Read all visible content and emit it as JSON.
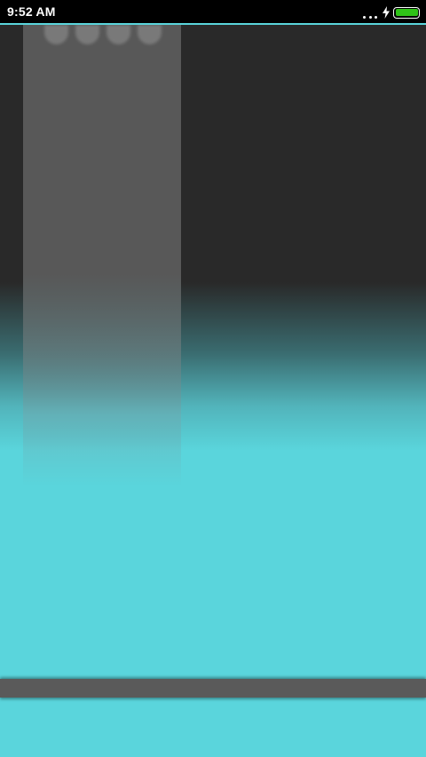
{
  "status_bar": {
    "time": "9:52 AM",
    "icons": [
      "more-dots-icon",
      "charging-bolt-icon",
      "battery-full-icon"
    ],
    "battery_level": 1.0
  },
  "page_indicator": {
    "dot_count": 4
  },
  "colors": {
    "background_accent": "#5ad5dc",
    "dark_surface": "#292929",
    "panel": "#585858",
    "bottom_bar": "#5a5a5a",
    "battery_fill": "#2fc317"
  }
}
